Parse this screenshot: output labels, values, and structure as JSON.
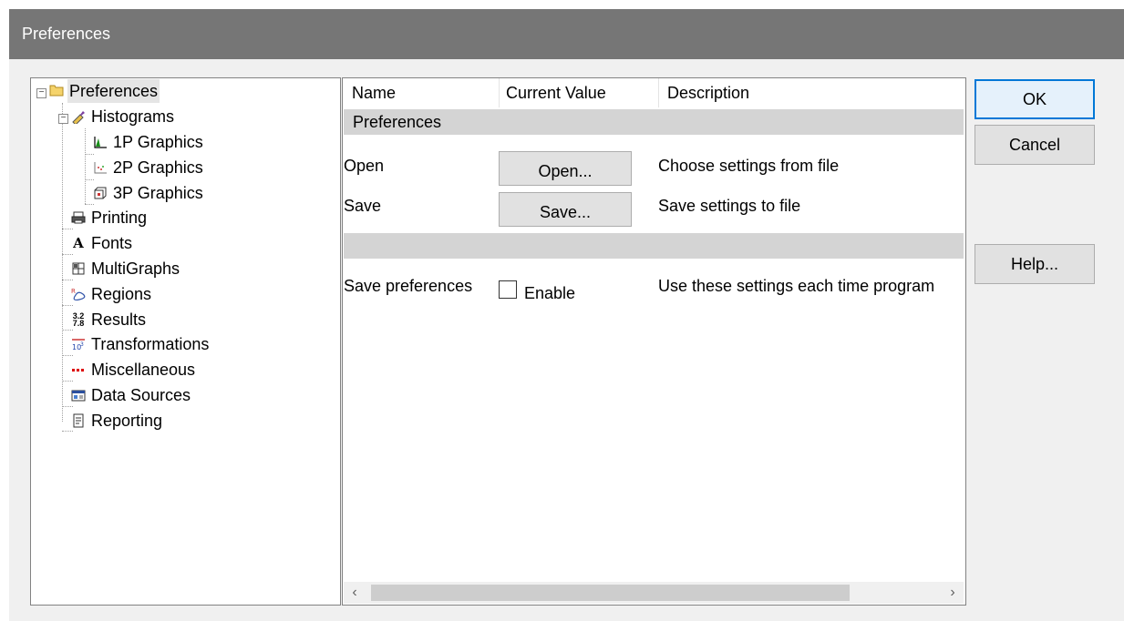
{
  "window": {
    "title": "Preferences"
  },
  "tree": {
    "items": [
      {
        "label": "Preferences",
        "icon": "folder-icon"
      },
      {
        "label": "Histograms",
        "icon": "histogram-tool-icon"
      },
      {
        "label": "1P Graphics",
        "icon": "1p-graph-icon"
      },
      {
        "label": "2P Graphics",
        "icon": "2p-graph-icon"
      },
      {
        "label": "3P Graphics",
        "icon": "3p-graph-icon"
      },
      {
        "label": "Printing",
        "icon": "printer-icon"
      },
      {
        "label": "Fonts",
        "icon": "font-icon"
      },
      {
        "label": "MultiGraphs",
        "icon": "multigraph-icon"
      },
      {
        "label": "Regions",
        "icon": "region-icon"
      },
      {
        "label": "Results",
        "icon": "results-icon"
      },
      {
        "label": "Transformations",
        "icon": "transformation-icon"
      },
      {
        "label": "Miscellaneous",
        "icon": "dots-icon"
      },
      {
        "label": "Data Sources",
        "icon": "data-source-icon"
      },
      {
        "label": "Reporting",
        "icon": "report-icon"
      }
    ]
  },
  "grid": {
    "columns": [
      "Name",
      "Current Value",
      "Description"
    ],
    "section_title": "Preferences",
    "rows": {
      "open": {
        "name": "Open",
        "button": "Open...",
        "description": "Choose settings from file"
      },
      "save": {
        "name": "Save",
        "button": "Save...",
        "description": "Save settings to file"
      },
      "save_prefs": {
        "name": "Save preferences",
        "checkbox_label": "Enable",
        "checked": false,
        "description": "Use these settings each time program"
      }
    }
  },
  "buttons": {
    "ok": "OK",
    "cancel": "Cancel",
    "help": "Help..."
  },
  "colors": {
    "titlebar": "#767676",
    "default_button_border": "#0078d7"
  }
}
